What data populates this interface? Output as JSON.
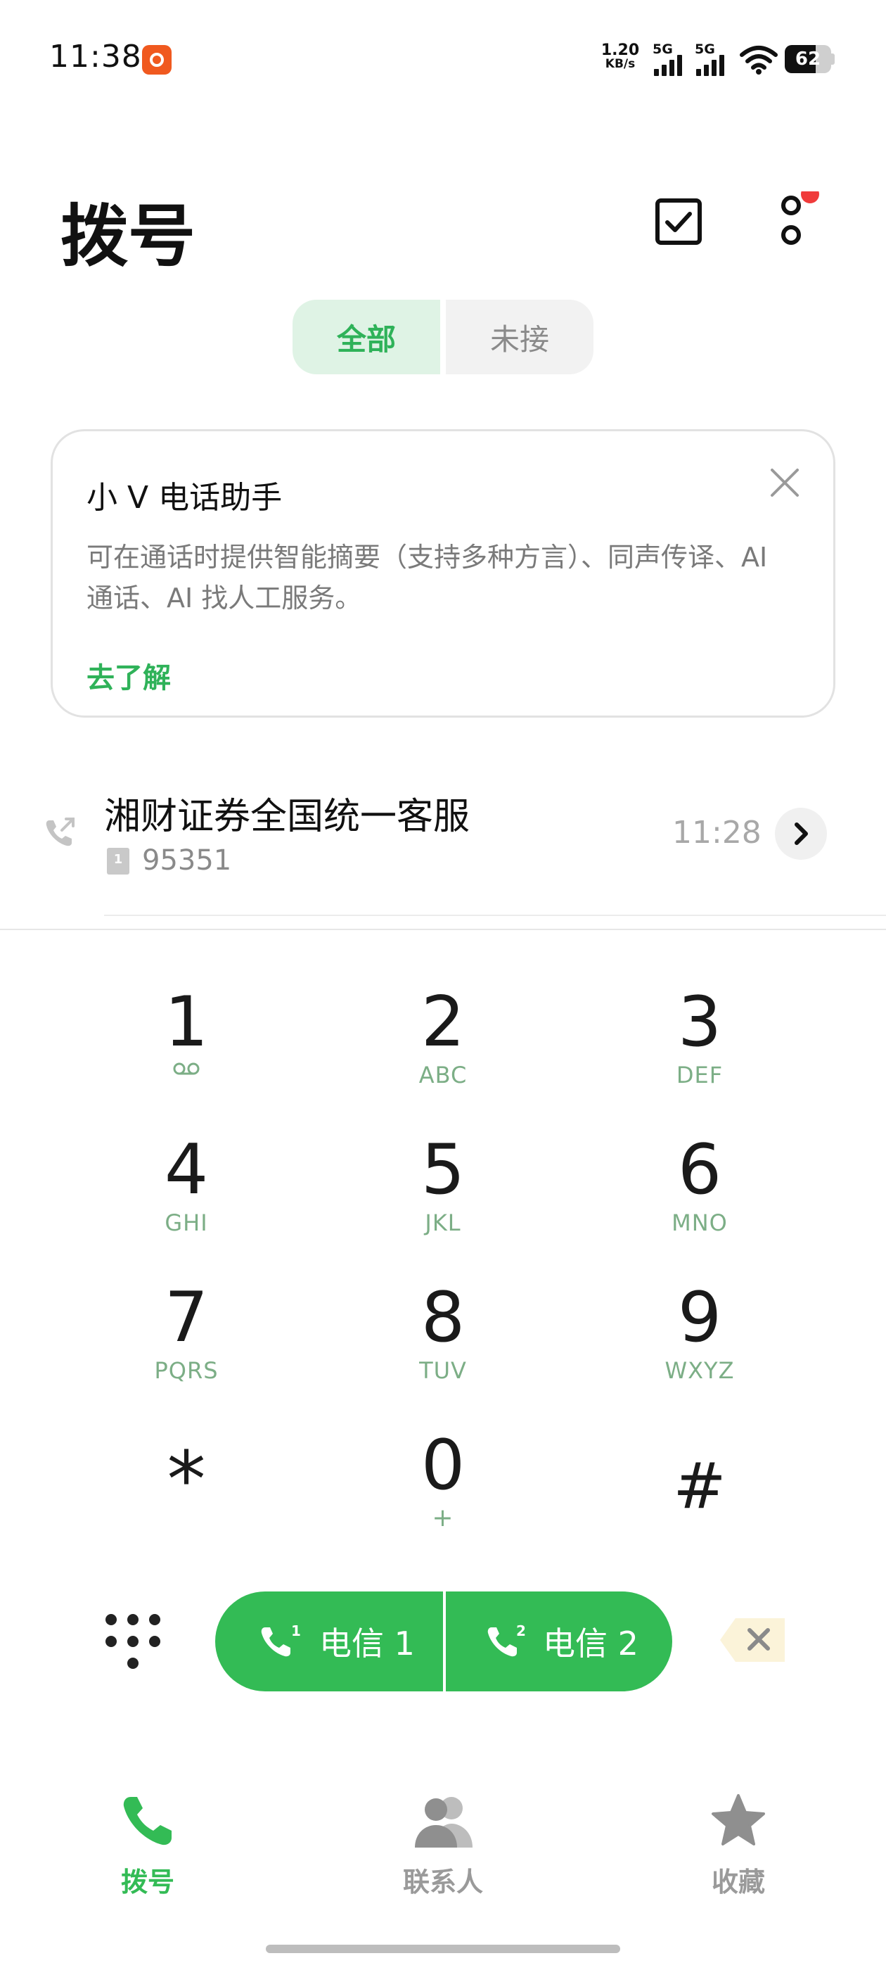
{
  "status_bar": {
    "time": "11:38",
    "net_speed_value": "1.20",
    "net_speed_unit": "KB/s",
    "sim1_network": "5G",
    "sim2_network": "5G",
    "battery": "62"
  },
  "header": {
    "title": "拨号"
  },
  "filter_tabs": [
    {
      "label": "全部",
      "selected": true
    },
    {
      "label": "未接",
      "selected": false
    }
  ],
  "assistant_card": {
    "title": "小 V 电话助手",
    "description": "可在通话时提供智能摘要（支持多种方言）、同声传译、AI 通话、AI 找人工服务。",
    "link": "去了解"
  },
  "call_log": [
    {
      "name": "湘财证券全国统一客服",
      "sim_slot": "1",
      "number": "95351",
      "time": "11:28"
    }
  ],
  "dialpad": [
    {
      "digit": "1",
      "letters": ""
    },
    {
      "digit": "2",
      "letters": "ABC"
    },
    {
      "digit": "3",
      "letters": "DEF"
    },
    {
      "digit": "4",
      "letters": "GHI"
    },
    {
      "digit": "5",
      "letters": "JKL"
    },
    {
      "digit": "6",
      "letters": "MNO"
    },
    {
      "digit": "7",
      "letters": "PQRS"
    },
    {
      "digit": "8",
      "letters": "TUV"
    },
    {
      "digit": "9",
      "letters": "WXYZ"
    },
    {
      "digit": "*",
      "letters": ""
    },
    {
      "digit": "0",
      "letters": "+"
    },
    {
      "digit": "#",
      "letters": ""
    }
  ],
  "call_buttons": {
    "sim1_label": "电信 1",
    "sim1_badge": "1",
    "sim2_label": "电信 2",
    "sim2_badge": "2"
  },
  "bottom_nav": [
    {
      "label": "拨号",
      "active": true
    },
    {
      "label": "联系人",
      "active": false
    },
    {
      "label": "收藏",
      "active": false
    }
  ],
  "colors": {
    "accent_green": "#33bb55",
    "notification_dot": "#f03b3b"
  },
  "icons": {
    "status_app": "app-notification-icon",
    "select": "checkbox-icon",
    "more": "more-vertical-icon",
    "voicemail": "voicemail-icon",
    "call_type": "outgoing-call-icon",
    "backspace": "backspace-icon",
    "dialpad_toggle": "dialpad-grid-icon"
  }
}
